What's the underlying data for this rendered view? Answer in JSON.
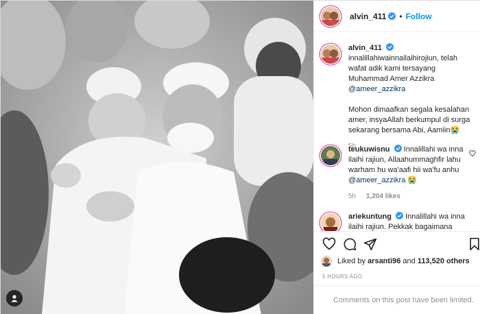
{
  "header": {
    "username": "alvin_411",
    "separator": "•",
    "follow_label": "Follow"
  },
  "caption": {
    "username": "alvin_411",
    "text": "innalillahiwainnailaihirojiun, telah wafat adik kami tersayang Muhammad Amer Azzikra",
    "mention": "@ameer_azzikra",
    "text2": "Mohon dimaafkan segala kesalahan amer, insyaAllah berkumpul di surga sekarang bersama Abi, Aamiin",
    "emoji": "😭",
    "time": "5h"
  },
  "comments": [
    {
      "username": "teukuwisnu",
      "text": "Innalillahi wa inna ilaihi rajiun, Allaahummaghfir lahu warham hu wa'aafi hii wa'fu anhu",
      "mention": "@ameer_azzikra",
      "emoji": "😭",
      "time": "5h",
      "likes": "1,204 likes"
    },
    {
      "username": "ariekuntung",
      "text": "Innalillahi wa inna ilaihi rajiun. Pekkak bagaimana"
    }
  ],
  "likes": {
    "prefix": "Liked by",
    "user": "arsanti96",
    "conj": "and",
    "count": "113,520 others"
  },
  "timestamp": "5 HOURS AGO",
  "limited_notice": "Comments on this post have been limited.",
  "colors": {
    "follow_blue": "#0095f6",
    "verified_blue": "#3897f0",
    "link": "#00376b",
    "muted": "#8e8e8e"
  },
  "icons": [
    "user-tag-icon",
    "verified-icon",
    "heart-icon",
    "comment-icon",
    "share-icon",
    "bookmark-icon"
  ]
}
